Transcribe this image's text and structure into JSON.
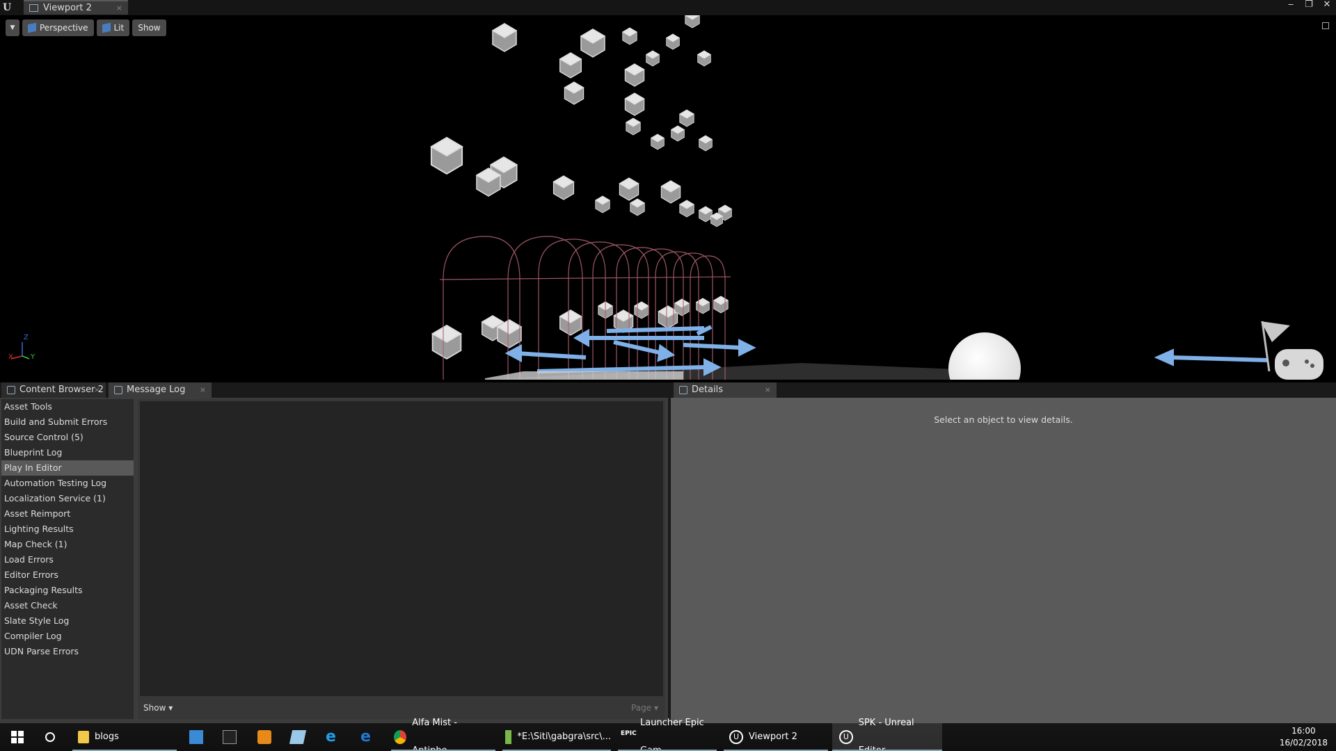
{
  "titlebar": {
    "tab_label": "Viewport 2",
    "tab_close": "×",
    "logo": "U",
    "controls": [
      "‒",
      "❐",
      "✕"
    ]
  },
  "viewport": {
    "perspective_label": "Perspective",
    "lit_label": "Lit",
    "show_label": "Show",
    "axis_x": "X",
    "axis_y": "Y",
    "axis_z": "Z"
  },
  "lower_tabs": {
    "content_browser": "Content Browser 2",
    "message_log": "Message Log",
    "details": "Details",
    "close": "×"
  },
  "message_log": {
    "categories": [
      "Asset Tools",
      "Build and Submit Errors",
      "Source Control (5)",
      "Blueprint Log",
      "Play In Editor",
      "Automation Testing Log",
      "Localization Service (1)",
      "Asset Reimport",
      "Lighting Results",
      "Map Check (1)",
      "Load Errors",
      "Editor Errors",
      "Packaging Results",
      "Asset Check",
      "Slate Style Log",
      "Compiler Log",
      "UDN Parse Errors"
    ],
    "selected": "Play In Editor",
    "show_label": "Show ▾",
    "page_label": "Page ▾"
  },
  "details": {
    "message": "Select an object to view details."
  },
  "taskbar": {
    "items": [
      {
        "label": "blogs",
        "icon": "folder-icon"
      },
      {
        "label": "Alfa Mist - Antipho...",
        "icon": "chrome-icon"
      },
      {
        "label": "*E:\\Siti\\gabgra\\src\\...",
        "icon": "notepad-icon"
      },
      {
        "label": "Launcher Epic Gam...",
        "icon": "epic-icon"
      },
      {
        "label": "Viewport 2",
        "icon": "unreal-icon"
      },
      {
        "label": "SPK - Unreal Editor",
        "icon": "unreal-icon"
      }
    ],
    "time": "16:00",
    "date": "16/02/2018"
  },
  "colors": {
    "accent_blue": "#7fb0e8",
    "cage_pink": "#b06070",
    "panel_dark": "#2b2b2b",
    "details_gray": "#5a5a5a"
  }
}
